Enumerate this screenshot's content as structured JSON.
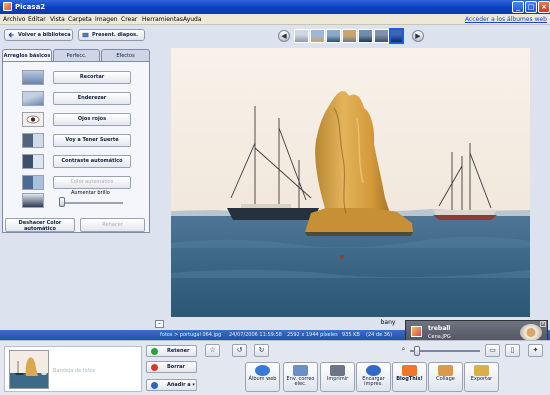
{
  "app": {
    "title": "Picasa2"
  },
  "menu": {
    "items": [
      "Archivo",
      "Editar",
      "Vista",
      "Carpeta",
      "Imagen",
      "Crear",
      "Herramientas",
      "Ayuda"
    ],
    "link": "Acceder a los álbumes web"
  },
  "toolbar": {
    "back_label": "Volver a biblioteca",
    "slideshow_label": "Present. diapos."
  },
  "tabs": [
    {
      "label": "Arreglos básicos",
      "active": true
    },
    {
      "label": "Perfecc."
    },
    {
      "label": "Efectos"
    }
  ],
  "tools": [
    {
      "label": "Recortar"
    },
    {
      "label": "Enderezar"
    },
    {
      "label": "Ojos rojos"
    },
    {
      "label": "Voy a Tener Suerte"
    },
    {
      "label": "Contraste automático"
    },
    {
      "label": "Color automático",
      "disabled": true
    }
  ],
  "brightness": {
    "label": "Aumentar brillo",
    "value": 0
  },
  "bottom_tools": {
    "undo_label": "Deshacer Color automático",
    "redo_label": "Rehacer"
  },
  "caption": {
    "value": "bany"
  },
  "status": {
    "path": "fotos > portugal 064.jpg",
    "datetime": "24/07/2006 11:59:58",
    "dimensions": "2592 x 1944 píxeles",
    "size": "935 KB",
    "position": "(24 de 36)"
  },
  "notification": {
    "title": "treball",
    "subtitle": "Cena.JPG"
  },
  "tray": {
    "label": "Bandeja de fotos",
    "actions": [
      {
        "label": "Retener",
        "color": "#2f9e3c"
      },
      {
        "label": "Borrar",
        "color": "#d33a2c"
      },
      {
        "label": "Añadir a ▾",
        "color": "#2d61c6"
      }
    ]
  },
  "actions": [
    {
      "label": "Álbum web",
      "icon": "web-album-icon",
      "color": "#3a78d8"
    },
    {
      "label": "Env. correo elec.",
      "icon": "email-icon",
      "color": "#6b8fc8"
    },
    {
      "label": "Imprimir",
      "icon": "print-icon",
      "color": "#6d7485"
    },
    {
      "label": "Encargar impres.",
      "icon": "order-prints-icon",
      "color": "#2f6ac8"
    },
    {
      "label": "BlogThis!",
      "icon": "blogger-icon",
      "color": "#f0762a"
    },
    {
      "label": "Collage",
      "icon": "collage-icon",
      "color": "#d79b4a"
    },
    {
      "label": "Exportar",
      "icon": "export-icon",
      "color": "#d8b046"
    }
  ]
}
